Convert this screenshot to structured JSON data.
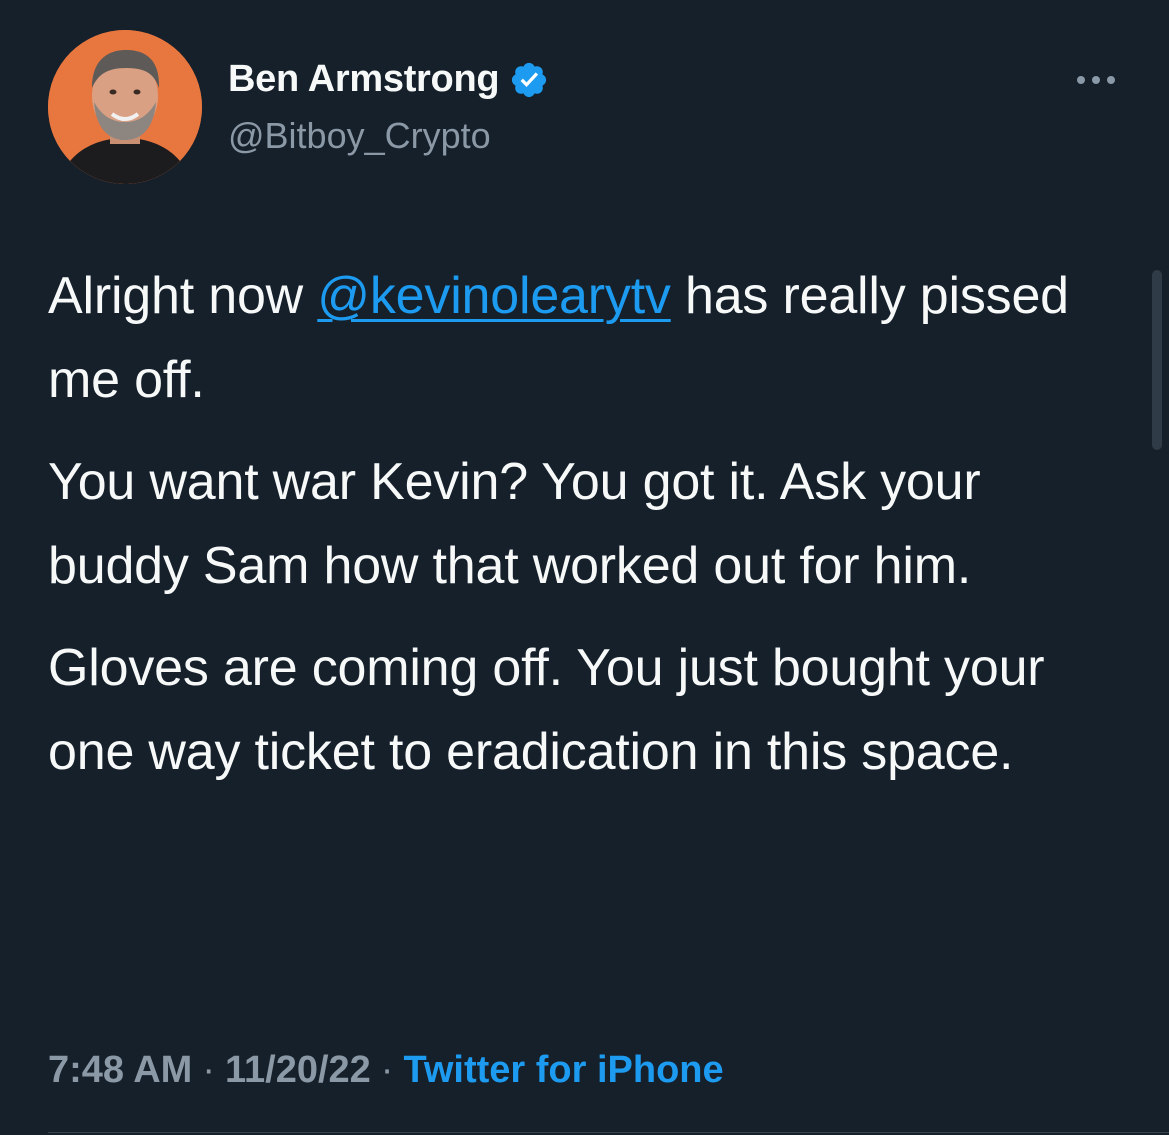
{
  "author": {
    "name": "Ben Armstrong",
    "handle": "@Bitboy_Crypto",
    "verified": true,
    "avatar_icon": "profile-photo",
    "verified_icon": "verified-badge-icon"
  },
  "menu": {
    "icon": "more-horizontal-icon"
  },
  "tweet": {
    "p1_before": "Alright now ",
    "p1_mention": "@kevinolearytv",
    "p1_after": " has really pissed me off.",
    "p2": "You want war Kevin? You got it. Ask your buddy Sam how that worked out for him.",
    "p3": "Gloves are coming off. You just bought your one way ticket to eradication in this space."
  },
  "meta": {
    "time": "7:48 AM",
    "date": "11/20/22",
    "separator": "·",
    "source": "Twitter for iPhone"
  },
  "colors": {
    "background": "#15202b",
    "text": "#f7f9f9",
    "secondary": "#8b98a5",
    "accent": "#1d9bf0"
  }
}
